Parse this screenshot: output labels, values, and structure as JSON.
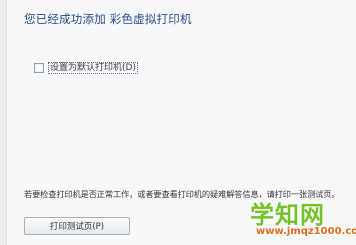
{
  "dialog": {
    "title": "您已经成功添加 彩色虚拟打印机",
    "default_printer_checkbox": {
      "label": "设置为默认打印机(D)",
      "checked": false
    },
    "info_text": "若要检查打印机是否正常工作，或者要查看打印机的疑难解答信息，请打印一张测试页。",
    "print_test_page_button": "打印测试页(P)"
  },
  "watermark": {
    "main": "学知网",
    "sub": "www.jmqz1000.com"
  },
  "colors": {
    "title": "#2a4c86",
    "watermark_green": "#74c12a",
    "watermark_orange": "#e36a1b"
  }
}
